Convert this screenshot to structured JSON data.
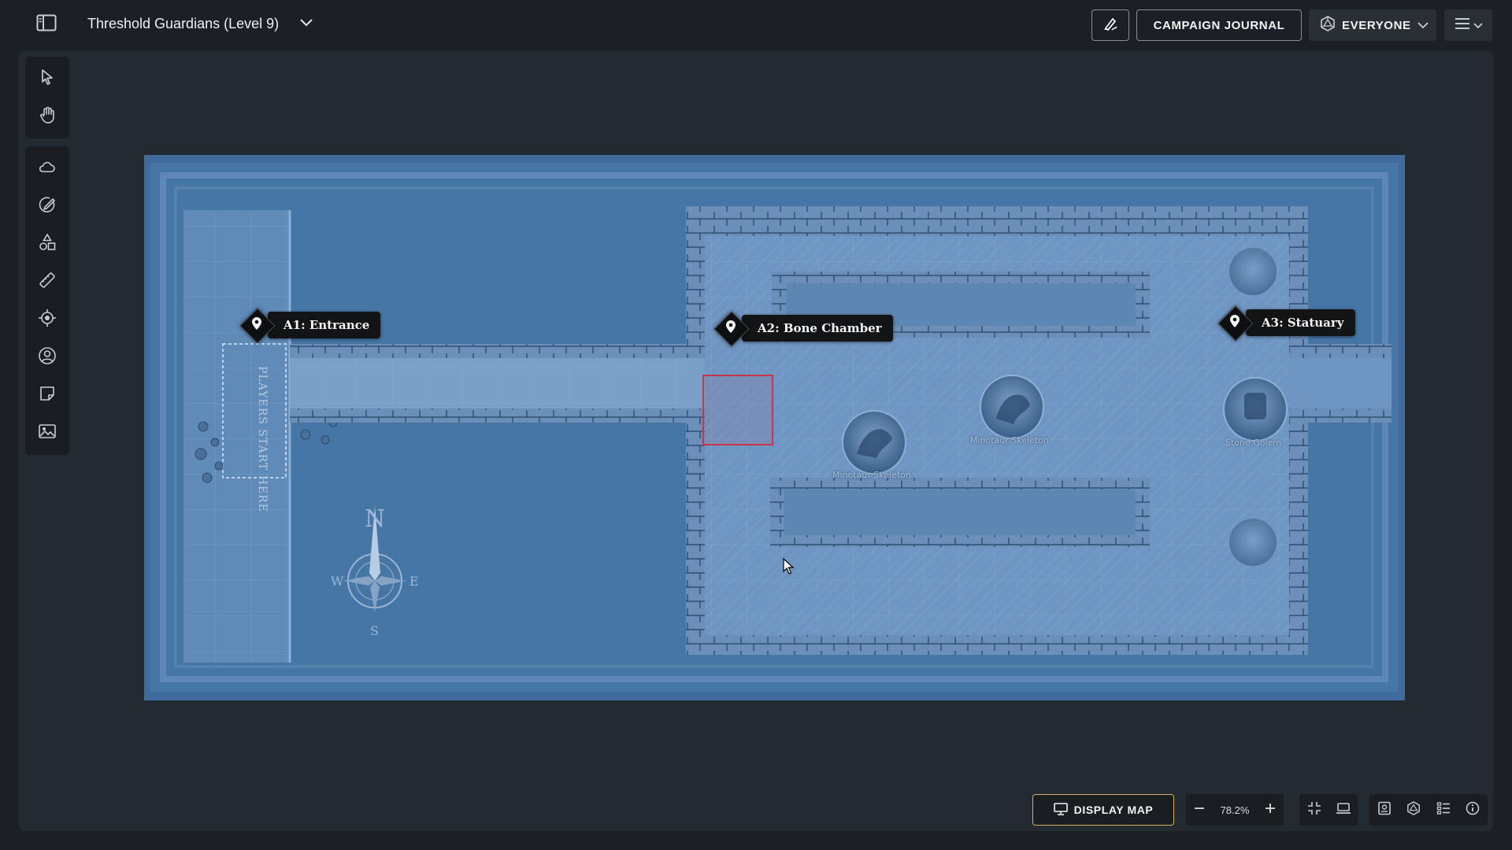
{
  "header": {
    "map_title": "Threshold Guardians (Level 9)",
    "journal_label": "CAMPAIGN JOURNAL",
    "audience_label": "EVERYONE"
  },
  "toolbar": {
    "top_tools": [
      "select-tool",
      "pan-tool"
    ],
    "main_tools": [
      "fog-tool",
      "draw-tool",
      "shapes-tool",
      "measure-tool",
      "ping-tool",
      "tokens-tool",
      "notes-tool",
      "image-tool"
    ]
  },
  "map": {
    "markers": [
      {
        "label": "A1: Entrance"
      },
      {
        "label": "A2: Bone Chamber"
      },
      {
        "label": "A3: Statuary"
      }
    ],
    "tokens": [
      {
        "label": "Minotaur Skeleton"
      },
      {
        "label": "Minotaur Skeleton"
      },
      {
        "label": "Stone Golem"
      }
    ],
    "start_label": "PLAYERS START HERE",
    "compass": {
      "n": "N",
      "s": "S",
      "e": "E",
      "w": "W"
    },
    "colors": {
      "overlay": "#3d6c9c",
      "selection": "#c8354a"
    }
  },
  "footer": {
    "display_map_label": "DISPLAY MAP",
    "zoom_level": "78.2%"
  },
  "colors": {
    "background": "#1c2026",
    "stage": "#242a31",
    "panel": "#1a1e23",
    "display_accent": "#cfb25b"
  }
}
